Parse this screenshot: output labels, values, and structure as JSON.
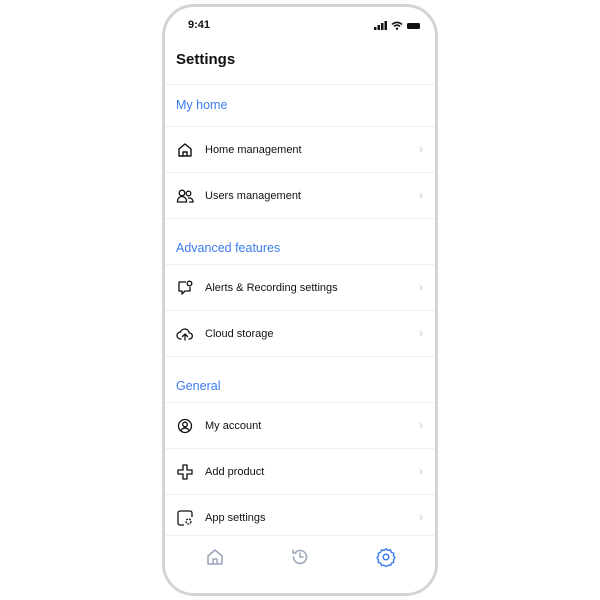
{
  "status": {
    "time": "9:41"
  },
  "header": {
    "title": "Settings"
  },
  "sections": [
    {
      "title": "My home",
      "items": [
        {
          "label": "Home management",
          "icon": "home-icon"
        },
        {
          "label": "Users management",
          "icon": "users-icon"
        }
      ]
    },
    {
      "title": "Advanced features",
      "items": [
        {
          "label": "Alerts & Recording settings",
          "icon": "alert-bubble-icon"
        },
        {
          "label": "Cloud storage",
          "icon": "cloud-upload-icon"
        }
      ]
    },
    {
      "title": "General",
      "items": [
        {
          "label": "My account",
          "icon": "account-icon"
        },
        {
          "label": "Add product",
          "icon": "plus-icon"
        },
        {
          "label": "App settings",
          "icon": "app-settings-icon"
        }
      ]
    }
  ],
  "tabs": [
    {
      "icon": "home-icon",
      "active": false
    },
    {
      "icon": "history-icon",
      "active": false
    },
    {
      "icon": "gear-icon",
      "active": true
    }
  ],
  "colors": {
    "accent": "#3b7cf0",
    "inactive": "#9aa3b8"
  }
}
